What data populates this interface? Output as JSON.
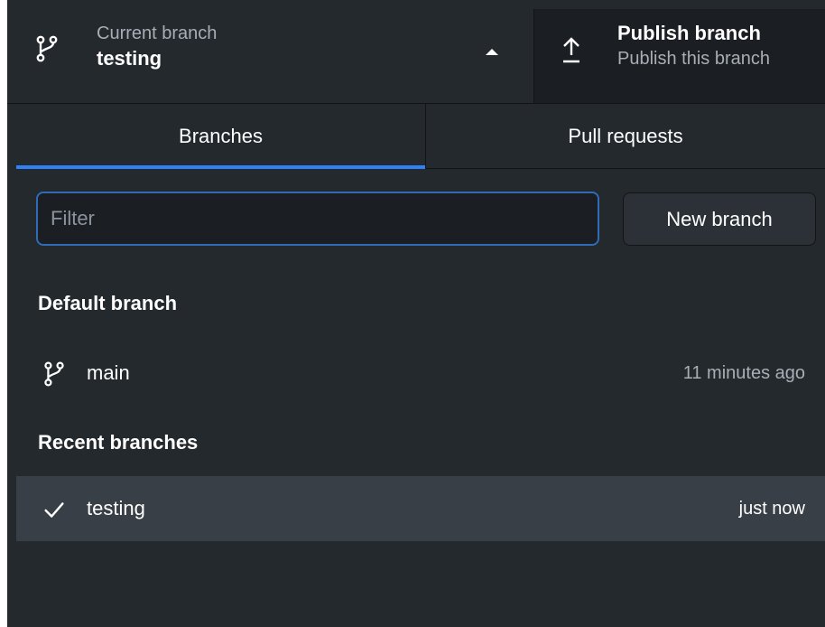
{
  "toolbar": {
    "current_branch": {
      "label": "Current branch",
      "value": "testing"
    },
    "publish": {
      "title": "Publish branch",
      "subtitle": "Publish this branch"
    }
  },
  "tabs": [
    {
      "label": "Branches",
      "active": true
    },
    {
      "label": "Pull requests",
      "active": false
    }
  ],
  "filter": {
    "placeholder": "Filter",
    "value": ""
  },
  "new_branch_label": "New branch",
  "default_section": {
    "title": "Default branch",
    "branches": [
      {
        "name": "main",
        "time": "11 minutes ago",
        "icon": "git-branch-icon"
      }
    ]
  },
  "recent_section": {
    "title": "Recent branches",
    "branches": [
      {
        "name": "testing",
        "time": "just now",
        "icon": "checkmark-icon",
        "selected": true
      }
    ]
  },
  "colors": {
    "background": "#24292e",
    "accent": "#2f81f7",
    "selected_row": "#393f46",
    "muted_text": "#a8aeb5"
  }
}
